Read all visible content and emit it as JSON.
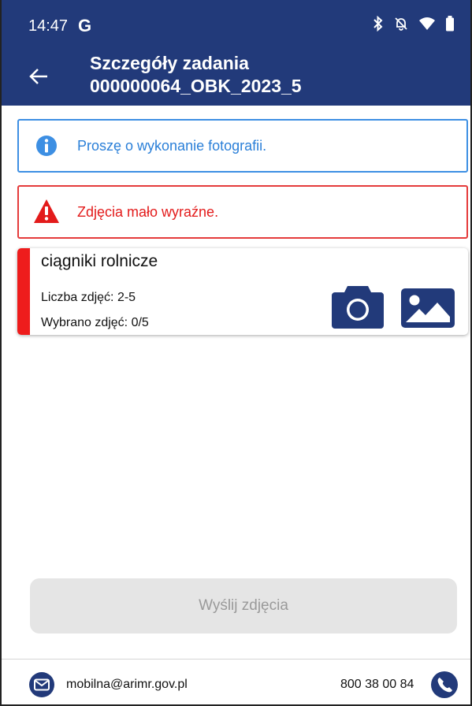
{
  "status_bar": {
    "time": "14:47",
    "g_label": "G",
    "icons": [
      "bluetooth-icon",
      "bell-off-icon",
      "wifi-icon",
      "battery-icon"
    ]
  },
  "header": {
    "title_line1": "Szczegóły zadania",
    "title_line2": "000000064_OBK_2023_5",
    "background": "#223a7a"
  },
  "alerts": {
    "info": {
      "text": "Proszę o wykonanie fotografii.",
      "color": "#3d8fe3"
    },
    "error": {
      "text": "Zdjęcia mało wyraźne.",
      "color": "#e53b3b"
    }
  },
  "photo_card": {
    "title": "ciągniki rolnicze",
    "count_text": "Liczba zdjęć: 2-5",
    "selected_text": "Wybrano zdjęć: 0/5",
    "accent": "#ee1c1c",
    "icons": [
      "camera-icon",
      "gallery-icon"
    ]
  },
  "send_button": {
    "label": "Wyślij zdjęcia"
  },
  "footer": {
    "email": "mobilna@arimr.gov.pl",
    "phone": "800 38 00 84",
    "icons": [
      "email-icon",
      "phone-icon"
    ]
  }
}
